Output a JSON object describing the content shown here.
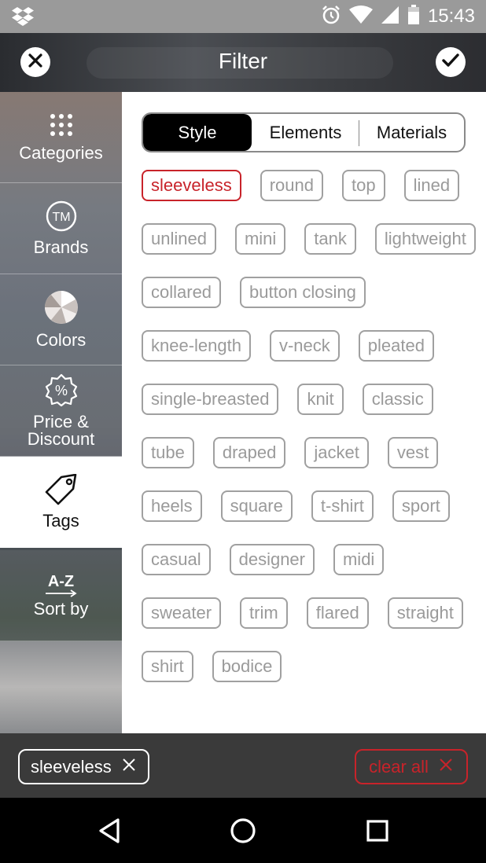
{
  "status_bar": {
    "time": "15:43",
    "icons": [
      "dropbox-icon",
      "alarm-icon",
      "wifi-icon",
      "signal-icon",
      "battery-icon"
    ]
  },
  "header": {
    "title": "Filter",
    "close_icon": "close-icon",
    "done_icon": "checkmark-icon"
  },
  "sidebar": {
    "items": [
      {
        "label": "Categories",
        "icon": "grid-dots-icon"
      },
      {
        "label": "Brands",
        "icon": "trademark-icon"
      },
      {
        "label": "Colors",
        "icon": "color-wheel-icon"
      },
      {
        "label": "Price &",
        "label2": "Discount",
        "icon": "percent-badge-icon"
      },
      {
        "label": "Tags",
        "icon": "tag-icon",
        "active": true
      },
      {
        "label": "Sort by",
        "icon": "a-z-sort-icon",
        "icon_text": "A-Z"
      }
    ]
  },
  "segments": [
    "Style",
    "Elements",
    "Materials"
  ],
  "active_segment": "Style",
  "tags": [
    {
      "label": "sleeveless",
      "selected": true
    },
    {
      "label": "round"
    },
    {
      "label": "top"
    },
    {
      "label": "lined"
    },
    {
      "label": "unlined"
    },
    {
      "label": "mini"
    },
    {
      "label": "tank"
    },
    {
      "label": "lightweight"
    },
    {
      "label": "collared"
    },
    {
      "label": "button closing"
    },
    {
      "label": "knee-length"
    },
    {
      "label": "v-neck"
    },
    {
      "label": "pleated"
    },
    {
      "label": "single-breasted"
    },
    {
      "label": "knit"
    },
    {
      "label": "classic"
    },
    {
      "label": "tube"
    },
    {
      "label": "draped"
    },
    {
      "label": "jacket"
    },
    {
      "label": "vest"
    },
    {
      "label": "heels"
    },
    {
      "label": "square"
    },
    {
      "label": "t-shirt"
    },
    {
      "label": "sport"
    },
    {
      "label": "casual"
    },
    {
      "label": "designer"
    },
    {
      "label": "midi"
    },
    {
      "label": "sweater"
    },
    {
      "label": "trim"
    },
    {
      "label": "flared"
    },
    {
      "label": "straight"
    },
    {
      "label": "shirt"
    },
    {
      "label": "bodice"
    }
  ],
  "selection_bar": {
    "chip_label": "sleeveless",
    "clear_label": "clear all"
  },
  "colors": {
    "accent_red": "#c8232a",
    "tag_gray": "#9a9a9a"
  }
}
